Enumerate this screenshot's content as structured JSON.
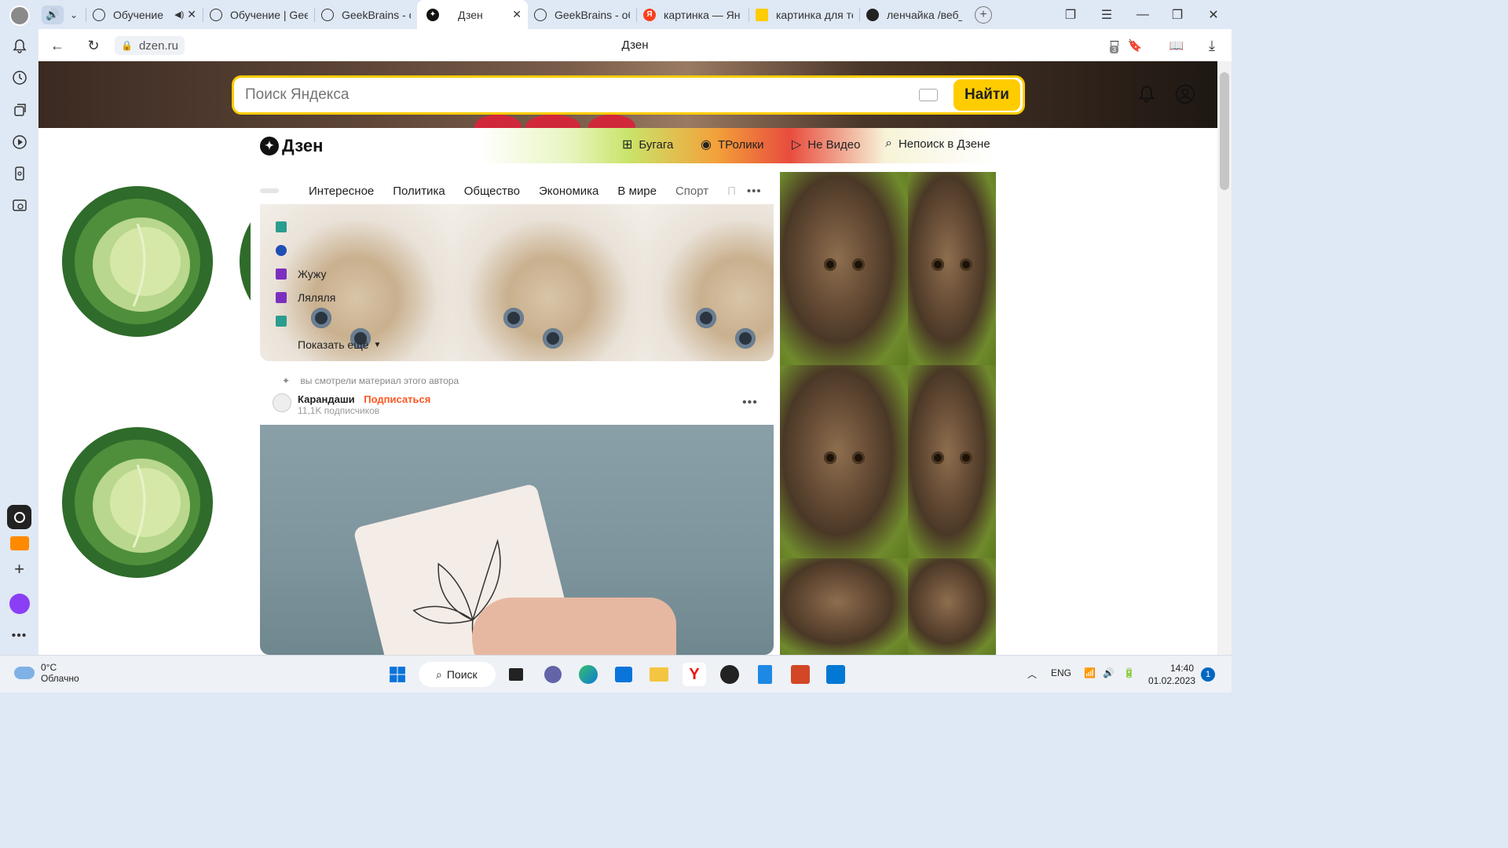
{
  "browser": {
    "tabs": [
      {
        "title": "Обучение",
        "icon": "openai-icon",
        "muted": true
      },
      {
        "title": "Обучение | Gee",
        "icon": "openai-icon"
      },
      {
        "title": "GeekBrains - об",
        "icon": "openai-icon"
      },
      {
        "title": "Дзен",
        "icon": "dzen-icon",
        "active": true
      },
      {
        "title": "GeekBrains - об",
        "icon": "openai-icon"
      },
      {
        "title": "картинка — Ян",
        "icon": "yandex-icon"
      },
      {
        "title": "картинка для те",
        "icon": "image-icon"
      },
      {
        "title": "ленчайка /веб_",
        "icon": "github-icon"
      }
    ],
    "url": "dzen.ru",
    "page_title": "Дзен",
    "ext_badge": "3"
  },
  "search": {
    "placeholder": "Поиск Яндекса",
    "button": "Найти"
  },
  "zen": {
    "logo": "Дзен",
    "nav": [
      {
        "label": "Бугага",
        "icon": "plus-square-icon"
      },
      {
        "label": "ТРолики",
        "icon": "shorts-icon"
      },
      {
        "label": "Не Видео",
        "icon": "play-icon"
      },
      {
        "label": "Непоиск в Дзене",
        "icon": "search-sparkle-icon"
      }
    ],
    "categories": [
      "Интересное",
      "Политика",
      "Общество",
      "Экономика",
      "В мире",
      "Спорт",
      "П"
    ],
    "sources": [
      {
        "label": "",
        "color": "#2a9d8f"
      },
      {
        "label": "",
        "color": "#1e4fb5"
      },
      {
        "label": "Жужу",
        "color": "#7b2fbf"
      },
      {
        "label": "Ляляля",
        "color": "#7b2fbf"
      },
      {
        "label": "",
        "color": "#2a9d8f"
      }
    ],
    "show_more": "Показать ещё",
    "post": {
      "meta": "вы смотрели материал этого автора",
      "author": "Карандаши",
      "subscribe": "Подписаться",
      "subscribers": "11,1K подписчиков"
    }
  },
  "taskbar": {
    "weather_temp": "0°C",
    "weather_desc": "Облачно",
    "search_label": "Поиск",
    "lang": "ENG",
    "time": "14:40",
    "date": "01.02.2023",
    "notifications": "1"
  }
}
